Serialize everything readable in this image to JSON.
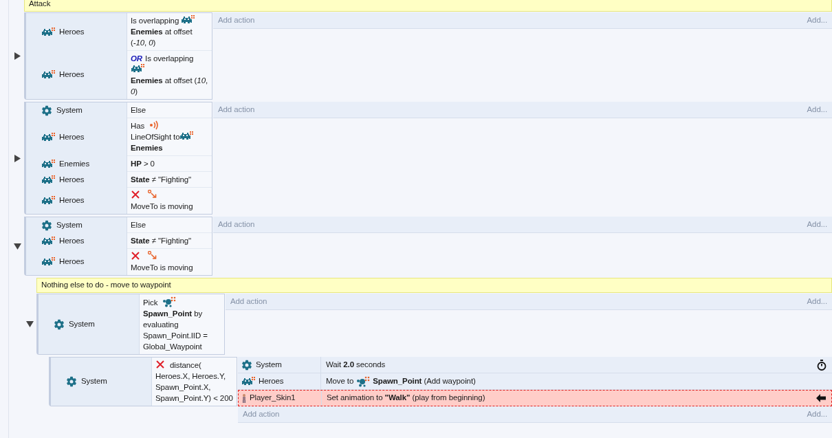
{
  "events": [
    {
      "comment": "Attack",
      "expanded": false,
      "conditions": [
        {
          "object": "Heroes",
          "kind": "sprite",
          "parts": [
            {
              "kind": "text",
              "text": "Is overlapping"
            },
            {
              "kind": "sprite"
            },
            {
              "kind": "text",
              "text": "**Enemies** at offset (*-10*, *0*)"
            }
          ]
        },
        {
          "object": "Heroes",
          "kind": "sprite",
          "parts": [
            {
              "kind": "or",
              "text": "OR"
            },
            {
              "kind": "text",
              "text": "Is overlapping"
            },
            {
              "kind": "sprite"
            },
            {
              "kind": "text",
              "text": "**Enemies** at offset (*10*, *0*)"
            }
          ]
        }
      ],
      "add_action": "Add action",
      "add_more": "Add..."
    },
    {
      "expanded": false,
      "conditions": [
        {
          "object": "System",
          "kind": "system",
          "parts": [
            {
              "kind": "text",
              "text": "Else"
            }
          ]
        },
        {
          "object": "Heroes",
          "kind": "sprite",
          "parts": [
            {
              "kind": "text",
              "text": "Has"
            },
            {
              "kind": "sight"
            },
            {
              "kind": "text",
              "text": "LineOfSight to"
            },
            {
              "kind": "sprite"
            },
            {
              "kind": "text",
              "text": "**Enemies**"
            }
          ]
        },
        {
          "object": "Enemies",
          "kind": "sprite",
          "parts": [
            {
              "kind": "text",
              "text": "**HP** > 0"
            }
          ]
        },
        {
          "object": "Heroes",
          "kind": "sprite",
          "parts": [
            {
              "kind": "text",
              "text": "**State** ≠ \"Fighting\""
            }
          ]
        },
        {
          "object": "Heroes",
          "kind": "sprite",
          "negated": true,
          "parts": [
            {
              "kind": "moveto"
            },
            {
              "kind": "text",
              "text": "MoveTo is moving"
            }
          ]
        }
      ],
      "add_action": "Add action",
      "add_more": "Add..."
    },
    {
      "expanded": true,
      "conditions": [
        {
          "object": "System",
          "kind": "system",
          "parts": [
            {
              "kind": "text",
              "text": "Else"
            }
          ]
        },
        {
          "object": "Heroes",
          "kind": "sprite",
          "parts": [
            {
              "kind": "text",
              "text": "**State** ≠ \"Fighting\""
            }
          ]
        },
        {
          "object": "Heroes",
          "kind": "sprite",
          "negated": true,
          "parts": [
            {
              "kind": "moveto"
            },
            {
              "kind": "text",
              "text": "MoveTo is moving"
            }
          ]
        }
      ],
      "add_action": "Add action",
      "add_more": "Add...",
      "children": [
        {
          "comment": "Nothing else to do - move to waypoint",
          "expanded": true,
          "conditions": [
            {
              "object": "System",
              "kind": "system",
              "parts": [
                {
                  "kind": "text",
                  "text": "Pick"
                },
                {
                  "kind": "points"
                },
                {
                  "kind": "text",
                  "text": "**Spawn_Point** by evaluating Spawn_Point.IID = Global_Waypoint"
                }
              ]
            }
          ],
          "add_action": "Add action",
          "add_more": "Add...",
          "children": [
            {
              "conditions": [
                {
                  "object": "System",
                  "kind": "system",
                  "negated": true,
                  "parts": [
                    {
                      "kind": "text",
                      "text": "distance( Heroes.X, Heroes.Y, Spawn_Point.X, Spawn_Point.Y) < 200"
                    }
                  ]
                }
              ],
              "actions": [
                {
                  "object": "System",
                  "kind": "system",
                  "async": true,
                  "breakpoint": false,
                  "parts": [
                    {
                      "kind": "text",
                      "text": "Wait **2.0** seconds"
                    }
                  ]
                },
                {
                  "object": "Heroes",
                  "kind": "sprite",
                  "async": false,
                  "breakpoint": false,
                  "parts": [
                    {
                      "kind": "text",
                      "text": "Move to"
                    },
                    {
                      "kind": "points"
                    },
                    {
                      "kind": "text",
                      "text": "**Spawn_Point** (Add waypoint)"
                    }
                  ]
                },
                {
                  "object": "Player_Skin1",
                  "kind": "person",
                  "async": false,
                  "breakpoint": true,
                  "parts": [
                    {
                      "kind": "text",
                      "text": "Set animation to **\"Walk\"** (play from beginning)"
                    }
                  ]
                }
              ],
              "add_action": "Add action",
              "add_more": "Add..."
            }
          ]
        }
      ]
    }
  ]
}
